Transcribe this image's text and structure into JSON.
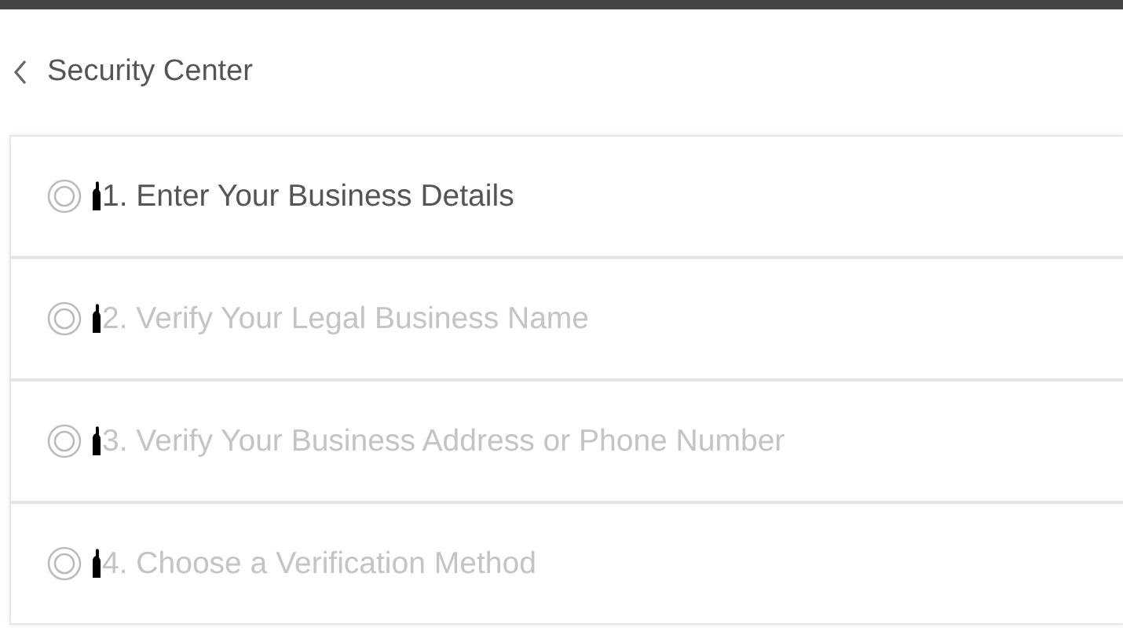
{
  "header": {
    "title": "Security Center"
  },
  "steps": [
    {
      "label": "1. Enter Your Business Details",
      "active": true
    },
    {
      "label": "2. Verify Your Legal Business Name",
      "active": false
    },
    {
      "label": "3. Verify Your Business Address or Phone Number",
      "active": false
    },
    {
      "label": "4. Choose a Verification Method",
      "active": false
    }
  ]
}
